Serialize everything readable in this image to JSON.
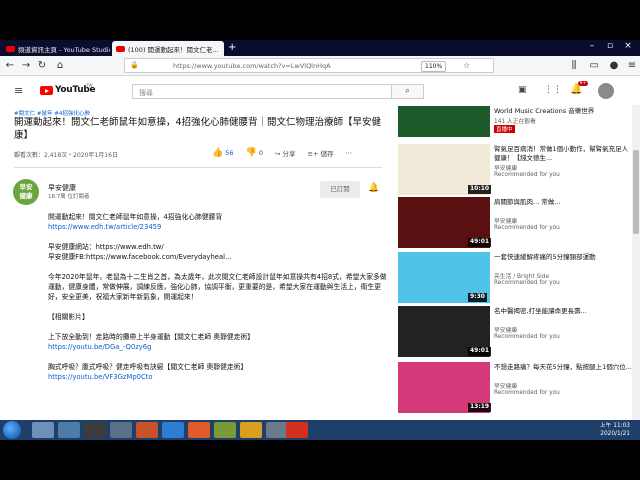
{
  "tabs": [
    {
      "label": "頻道資訊主頁 - YouTube Studio",
      "active": false
    },
    {
      "label": "(100) 開運動起來！閱文仁老...",
      "active": true
    }
  ],
  "browser": {
    "url": "https://www.youtube.com/watch?v=LwVlQlnHqA",
    "zoom": "110%"
  },
  "youtube": {
    "logo": "YouTube",
    "region": "TW",
    "search_placeholder": "搜尋",
    "notif_count": "9+"
  },
  "video": {
    "tags": "#閱文仁 #鼠年 #4招強化心肺",
    "title": "開運動起來！閱文仁老師鼠年如意操，4招強化心肺健腰背｜閱文仁物理治療師【早安健康】",
    "meta": "觀看次數：2,418次・2020年1月16日",
    "likes": "56",
    "dislikes": "0",
    "share": "分享",
    "save": "儲存"
  },
  "channel": {
    "avatar_text": "早安\n健康",
    "name": "早安健康",
    "subs": "18.7萬 位訂閱者",
    "subscribed_label": "已訂閱"
  },
  "description": [
    {
      "text": "開運動起來！閱文仁老師鼠年如意操，4招強化心肺健腰背",
      "link": false
    },
    {
      "text": "https://www.edh.tw/article/23459",
      "link": true
    },
    {
      "text": "",
      "link": false
    },
    {
      "text": "早安健康網站：https://www.edh.tw/",
      "link": false
    },
    {
      "text": "早安健康FB:https://www.facebook.com/Everydayheal...",
      "link": false
    },
    {
      "text": "",
      "link": false
    },
    {
      "text": "今年2020年鼠年，老鼠為十二生肖之首，為太歲年，此次閱文仁老師設計鼠年如意操共有4招8式，希望大家多做運動，健康身體，常做伸展，調練反應，強化心肺，協調平衡，更重要的是，希望大家在運動與生活上，衛生更好，安全更美，祝福大家新年新氣象，開運起來！",
      "link": false
    },
    {
      "text": "",
      "link": false
    },
    {
      "text": "【相關影片】",
      "link": false
    },
    {
      "text": "",
      "link": false
    },
    {
      "text": "上下放全動到！走路時的攤帶上半身運動【閱文仁老師 奧靜健走術】",
      "link": false
    },
    {
      "text": "https://youtu.be/DGa_-Q0zy6g",
      "link": true
    },
    {
      "text": "",
      "link": false
    },
    {
      "text": "胸式呼吸？腹式呼吸？健走呼吸有訣竅【閱文仁老師 奧靜健走術】",
      "link": false
    },
    {
      "text": "https://youtu.be/VF3GzMp0Cto",
      "link": true
    }
  ],
  "sidebar": [
    {
      "title": "World Music Creations 音樂世界",
      "sub1": "141 人正在觀看",
      "sub2": "",
      "duration": "",
      "live": "直播中",
      "thumb_bg": "#1e5a2a"
    },
    {
      "title": "腎氣足百病消！常做1個小動作，幫腎氣充足人健康！【錢文德生...",
      "sub1": "早安健康",
      "sub2": "Recommended for you",
      "duration": "10:10",
      "live": "",
      "thumb_bg": "#f2ead8"
    },
    {
      "title": "肩關節與肌肉... 常做...",
      "sub1": "早安健康",
      "sub2": "Recommended for you",
      "duration": "49:01",
      "live": "",
      "thumb_bg": "#5a1010"
    },
    {
      "title": "一套快速緩解疼痛的5分鐘頸部運動",
      "sub1": "亮生活 / Bright Side",
      "sub2": "Recommended for you",
      "duration": "9:30",
      "live": "",
      "thumb_bg": "#4fc4e8"
    },
    {
      "title": "名中醫揭密,打坐能讓命更長壽...",
      "sub1": "早安健康",
      "sub2": "Recommended for you",
      "duration": "49:01",
      "live": "",
      "thumb_bg": "#222"
    },
    {
      "title": "不想走路痛？每天花5分鐘，點按腿上1個穴位...",
      "sub1": "早安健康",
      "sub2": "Recommended for you",
      "duration": "13:19",
      "live": "",
      "thumb_bg": "#d43a7a"
    }
  ],
  "taskbar": {
    "time": "上午 11:03",
    "date": "2020/1/21"
  }
}
